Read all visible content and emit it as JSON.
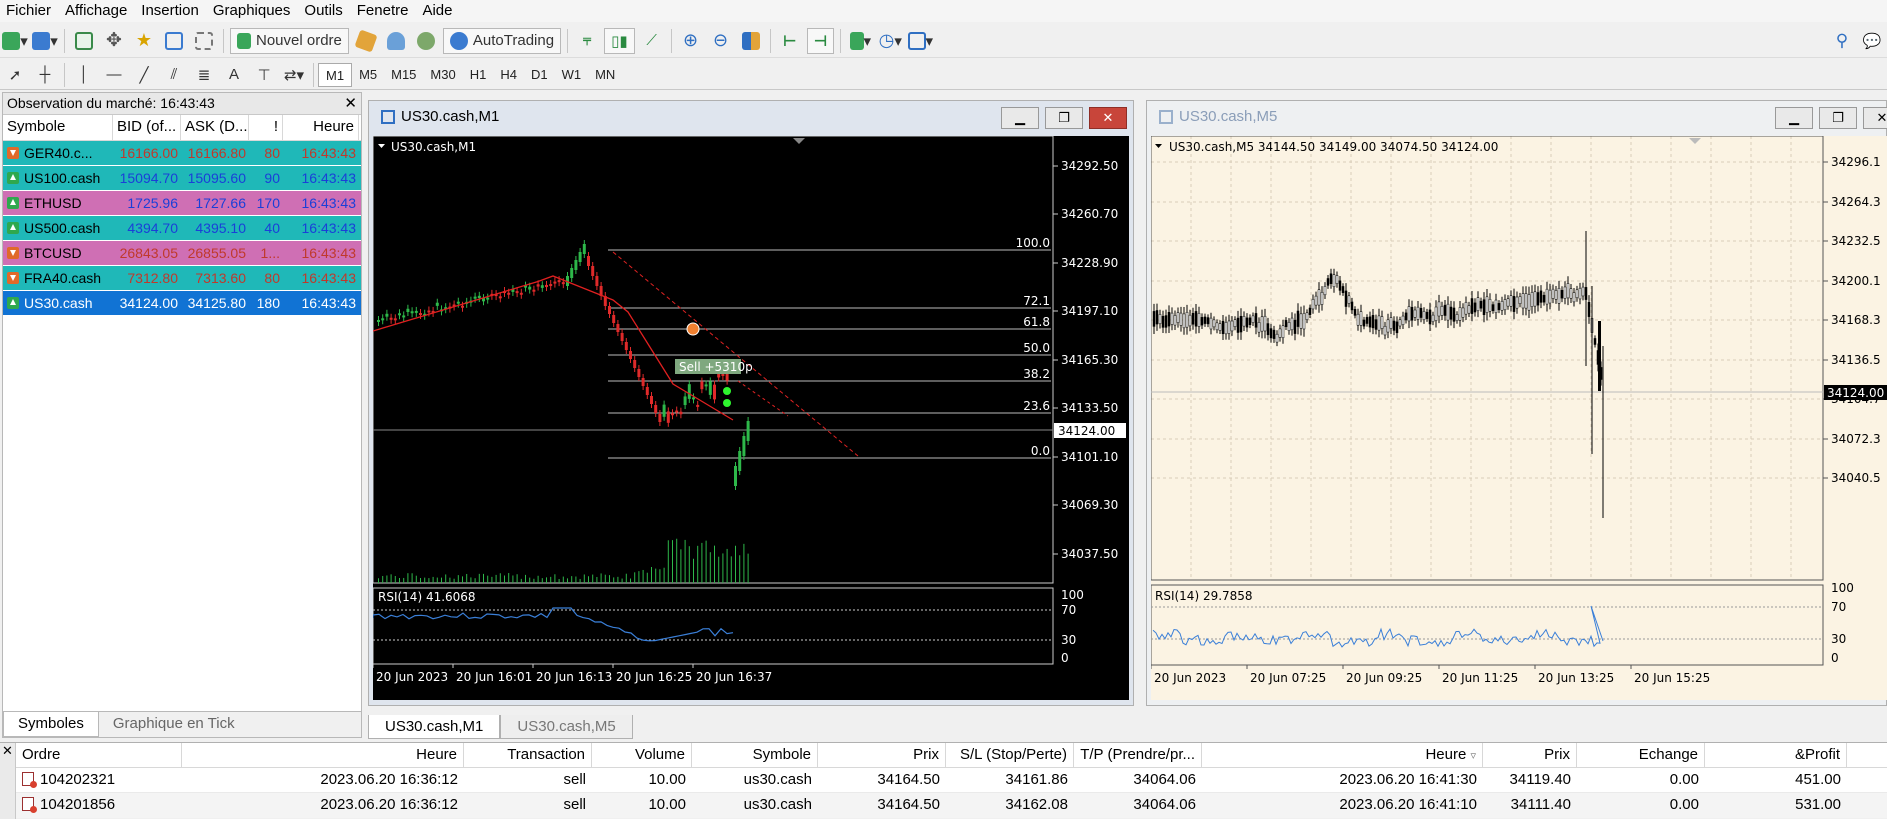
{
  "menu": [
    "Fichier",
    "Affichage",
    "Insertion",
    "Graphiques",
    "Outils",
    "Fenetre",
    "Aide"
  ],
  "toolbar": {
    "new_order": "Nouvel ordre",
    "autotrading": "AutoTrading"
  },
  "timeframes": [
    "M1",
    "M5",
    "M15",
    "M30",
    "H1",
    "H4",
    "D1",
    "W1",
    "MN"
  ],
  "timeframe_active": "M1",
  "market_watch": {
    "title": "Observation du marché: 16:43:43",
    "headers": [
      "Symbole",
      "BID (of...",
      "ASK (D...",
      "!",
      "Heure"
    ],
    "rows": [
      {
        "symbol": "GER40.c...",
        "bid": "16166.00",
        "ask": "16166.80",
        "spread": "80",
        "time": "16:43:43",
        "dir": "down",
        "bg": "#1fb8b8",
        "fg": "#c0392b"
      },
      {
        "symbol": "US100.cash",
        "bid": "15094.70",
        "ask": "15095.60",
        "spread": "90",
        "time": "16:43:43",
        "dir": "up",
        "bg": "#1fb8b8",
        "fg": "#1a3fd8"
      },
      {
        "symbol": "ETHUSD",
        "bid": "1725.96",
        "ask": "1727.66",
        "spread": "170",
        "time": "16:43:43",
        "dir": "up",
        "bg": "#cf6fb4",
        "fg": "#1a3fd8"
      },
      {
        "symbol": "US500.cash",
        "bid": "4394.70",
        "ask": "4395.10",
        "spread": "40",
        "time": "16:43:43",
        "dir": "up",
        "bg": "#1fb8b8",
        "fg": "#1a3fd8"
      },
      {
        "symbol": "BTCUSD",
        "bid": "26843.05",
        "ask": "26855.05",
        "spread": "1...",
        "time": "16:43:43",
        "dir": "down",
        "bg": "#cf6fb4",
        "fg": "#c0392b"
      },
      {
        "symbol": "FRA40.cash",
        "bid": "7312.80",
        "ask": "7313.60",
        "spread": "80",
        "time": "16:43:43",
        "dir": "down",
        "bg": "#1fb8b8",
        "fg": "#c0392b"
      },
      {
        "symbol": "US30.cash",
        "bid": "34124.00",
        "ask": "34125.80",
        "spread": "180",
        "time": "16:43:43",
        "dir": "up",
        "bg": "#1173d4",
        "fg": "#ffffff"
      }
    ],
    "tabs": [
      "Symboles",
      "Graphique en Tick"
    ]
  },
  "chart1": {
    "window_title": "US30.cash,M1",
    "label": "US30.cash,M1",
    "price_labels": [
      "34292.50",
      "34260.70",
      "34228.90",
      "34197.10",
      "34165.30",
      "34133.50",
      "34101.10",
      "34069.30",
      "34037.50"
    ],
    "current_price": "34124.00",
    "fib_levels": [
      "100.0",
      "72.1",
      "61.8",
      "50.0",
      "38.2",
      "23.6",
      "0.0"
    ],
    "trade_label": "Sell +5310p",
    "rsi_label": "RSI(14) 41.6068",
    "rsi_scale": [
      "100",
      "70",
      "30",
      "0"
    ],
    "time_labels": [
      "20 Jun 2023",
      "20 Jun 16:01",
      "20 Jun 16:13",
      "20 Jun 16:25",
      "20 Jun 16:37"
    ]
  },
  "chart2": {
    "window_title": "US30.cash,M5",
    "label": "US30.cash,M5  34144.50 34149.00 34074.50 34124.00",
    "price_labels": [
      "34296.1",
      "34264.3",
      "34232.5",
      "34200.1",
      "34168.3",
      "34136.5",
      "34104.7",
      "34072.3",
      "34040.5"
    ],
    "current_price": "34124.00",
    "rsi_label": "RSI(14) 29.7858",
    "rsi_scale": [
      "100",
      "70",
      "30",
      "0"
    ],
    "time_labels": [
      "20 Jun 2023",
      "20 Jun 07:25",
      "20 Jun 09:25",
      "20 Jun 11:25",
      "20 Jun 13:25",
      "20 Jun 15:25"
    ]
  },
  "chart_tabs": [
    "US30.cash,M1",
    "US30.cash,M5"
  ],
  "terminal": {
    "headers": [
      "Ordre",
      "Heure",
      "Transaction",
      "Volume",
      "Symbole",
      "Prix",
      "S/L (Stop/Perte)",
      "T/P (Prendre/pr...",
      "Heure",
      "Prix",
      "Echange",
      "&Profit"
    ],
    "rows": [
      [
        "104202321",
        "2023.06.20 16:36:12",
        "sell",
        "10.00",
        "us30.cash",
        "34164.50",
        "34161.86",
        "34064.06",
        "2023.06.20 16:41:30",
        "34119.40",
        "0.00",
        "451.00"
      ],
      [
        "104201856",
        "2023.06.20 16:36:12",
        "sell",
        "10.00",
        "us30.cash",
        "34164.50",
        "34162.08",
        "34064.06",
        "2023.06.20 16:41:10",
        "34111.40",
        "0.00",
        "531.00"
      ]
    ]
  }
}
